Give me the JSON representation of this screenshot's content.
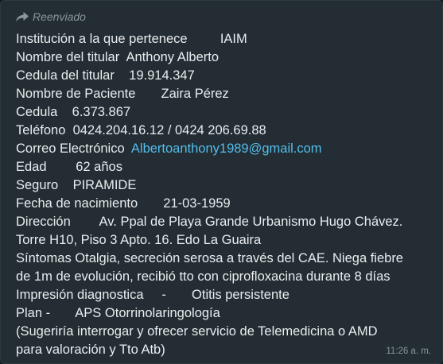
{
  "message": {
    "forwarded_label": "Reenviado",
    "lines": [
      {
        "label": "Institución a la que pertenece",
        "sep": "         ",
        "value": "IAIM"
      },
      {
        "label": "Nombre del titular",
        "sep": "  ",
        "value": "Anthony Alberto"
      },
      {
        "label": "Cedula del titular",
        "sep": "    ",
        "value": "19.914.347"
      },
      {
        "label": "Nombre de Paciente",
        "sep": "       ",
        "value": "Zaira Pérez"
      },
      {
        "label": "Cedula",
        "sep": "    ",
        "value": "6.373.867"
      },
      {
        "label": "Teléfono",
        "sep": "  ",
        "value": "0424.204.16.12 / 0424 206.69.88"
      },
      {
        "label": "Correo Electrónico",
        "sep": "  ",
        "email": "Albertoanthony1989@gmail.com"
      },
      {
        "label": "Edad",
        "sep": "        ",
        "value": "62 años"
      },
      {
        "label": "Seguro",
        "sep": "    ",
        "value": "PIRAMIDE"
      },
      {
        "label": "Fecha de nacimiento",
        "sep": "       ",
        "value": "21-03-1959"
      },
      {
        "label": "Dirección",
        "sep": "        ",
        "value": "Av. Ppal de Playa Grande Urbanismo Hugo Chávez."
      },
      {
        "text": "Torre H10, Piso 3 Apto. 16. Edo La Guaira"
      },
      {
        "text": "Síntomas Otalgia, secreción serosa a través del CAE. Niega fiebre"
      },
      {
        "text": "de 1m de evolución, recibió tto con ciprofloxacina durante 8 días"
      },
      {
        "label": "Impresión diagnostica",
        "sep": "     -       ",
        "value": "Otitis persistente"
      },
      {
        "label": "Plan -",
        "sep": "       ",
        "value": "APS Otorrinolaringología"
      },
      {
        "text": "(Sugeriría interrogar y ofrecer servicio de Telemedicina o AMD"
      },
      {
        "text": "para valoración y Tto Atb)"
      }
    ],
    "timestamp": "11:26 a. m."
  },
  "icons": {
    "forwarded": "forward-arrow-icon"
  },
  "colors": {
    "bubble_bg": "#232d33",
    "text": "#e9edef",
    "meta_text": "#8a969c",
    "link": "#53bdeb"
  }
}
